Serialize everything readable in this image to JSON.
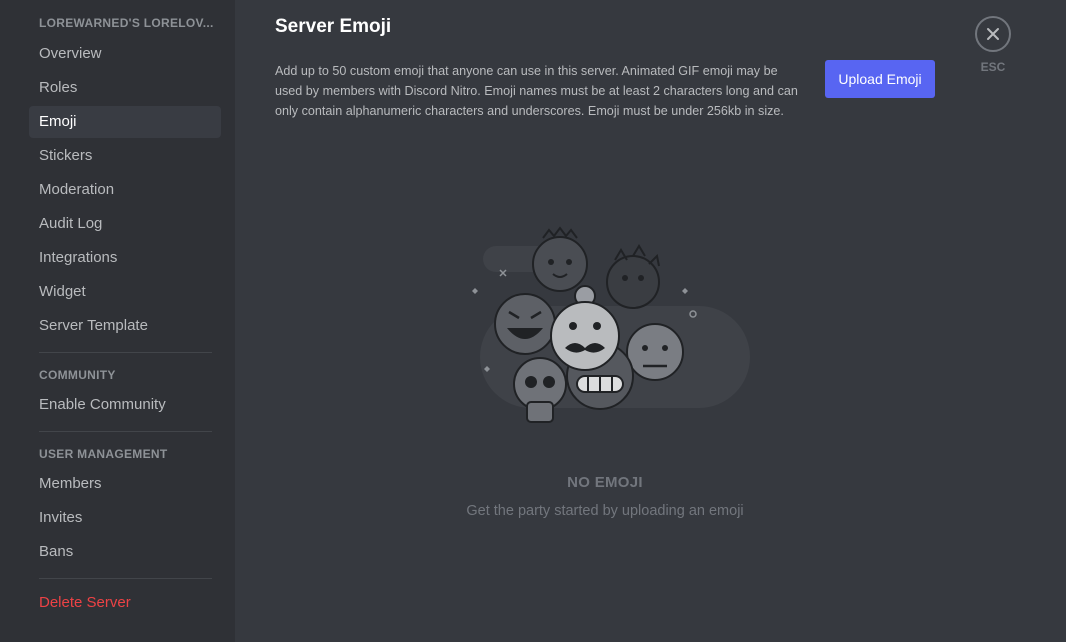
{
  "sidebar": {
    "server_name": "LOREWARNED'S LORELOV...",
    "items_main": [
      {
        "label": "Overview"
      },
      {
        "label": "Roles"
      },
      {
        "label": "Emoji"
      },
      {
        "label": "Stickers"
      },
      {
        "label": "Moderation"
      },
      {
        "label": "Audit Log"
      },
      {
        "label": "Integrations"
      },
      {
        "label": "Widget"
      },
      {
        "label": "Server Template"
      }
    ],
    "community_header": "COMMUNITY",
    "items_community": [
      {
        "label": "Enable Community"
      }
    ],
    "user_mgmt_header": "USER MANAGEMENT",
    "items_user_mgmt": [
      {
        "label": "Members"
      },
      {
        "label": "Invites"
      },
      {
        "label": "Bans"
      }
    ],
    "delete_label": "Delete Server",
    "active_item": "Emoji"
  },
  "main": {
    "title": "Server Emoji",
    "description": "Add up to 50 custom emoji that anyone can use in this server. Animated GIF emoji may be used by members with Discord Nitro. Emoji names must be at least 2 characters long and can only contain alphanumeric characters and underscores. Emoji must be under 256kb in size.",
    "upload_label": "Upload Emoji",
    "close_icon": "close-icon",
    "esc_label": "ESC",
    "empty_title": "NO EMOJI",
    "empty_subtitle": "Get the party started by uploading an emoji"
  },
  "colors": {
    "sidebar_bg": "#2f3136",
    "main_bg": "#36393f",
    "accent": "#5865f2",
    "danger": "#ed4245",
    "active_item_bg": "#393c43"
  }
}
